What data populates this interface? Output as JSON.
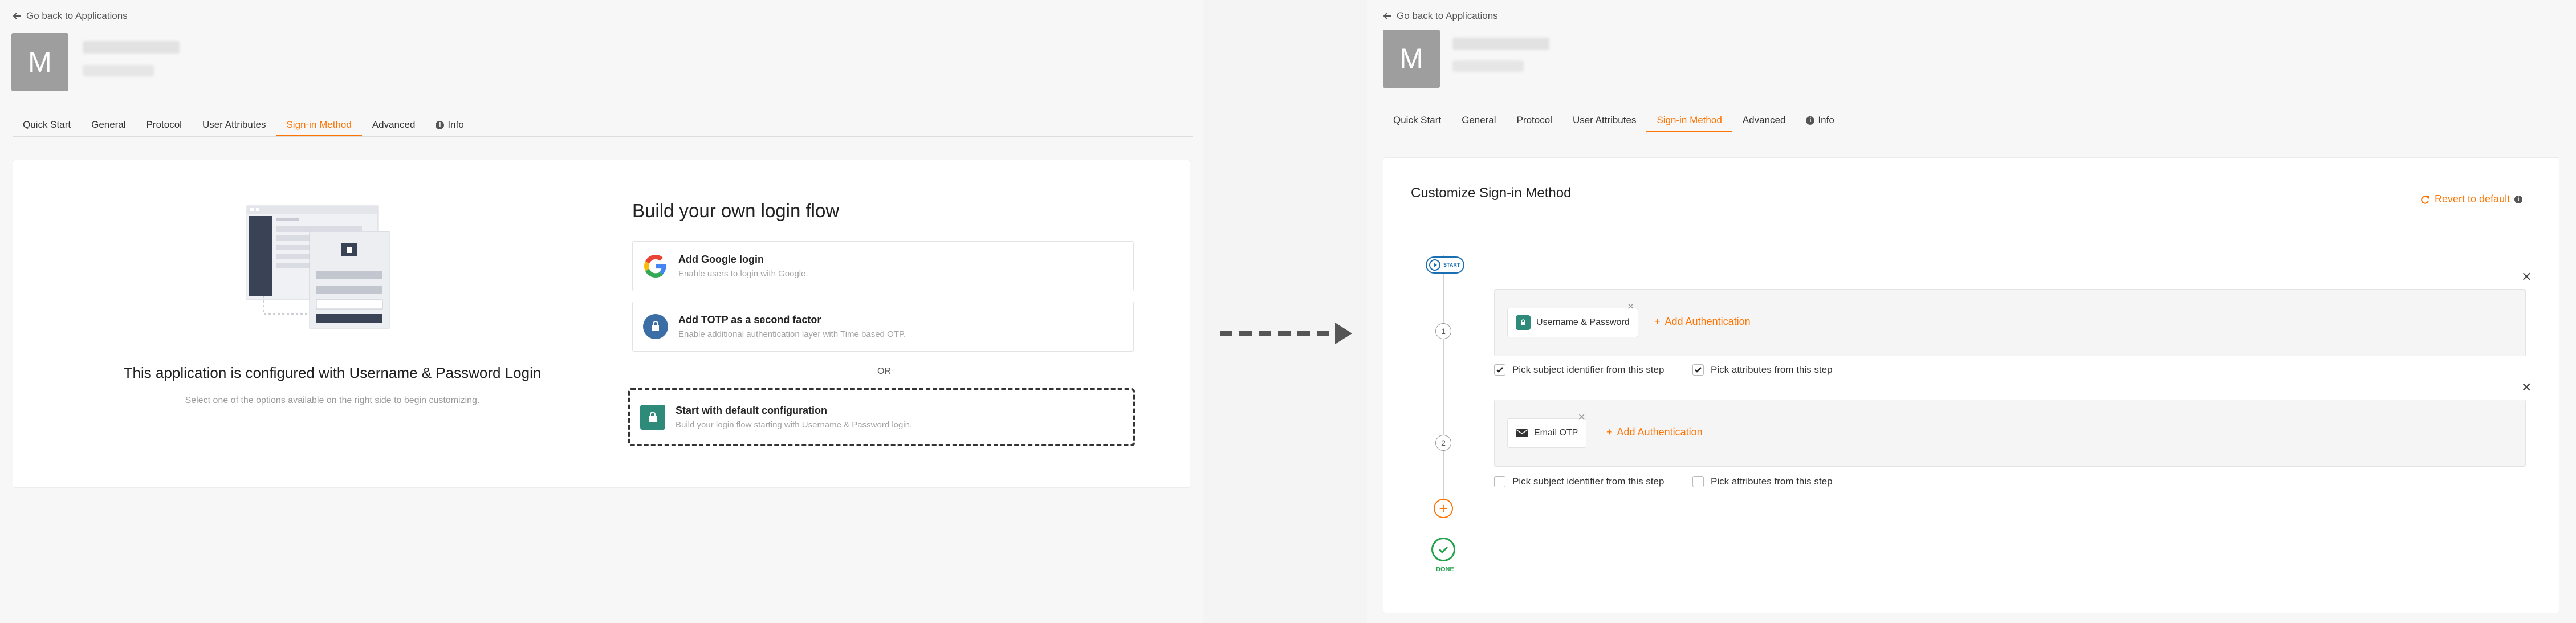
{
  "left": {
    "back_link": "Go back to Applications",
    "avatar_letter": "M",
    "tabs": [
      "Quick Start",
      "General",
      "Protocol",
      "User Attributes",
      "Sign-in Method",
      "Advanced",
      "Info"
    ],
    "active_tab": "Sign-in Method",
    "config_title": "This application is configured with Username & Password Login",
    "config_subtitle": "Select one of the options available on the right side to begin customizing.",
    "build_title": "Build your own login flow",
    "options": [
      {
        "title": "Add Google login",
        "description": "Enable users to login with Google.",
        "icon": "google-icon"
      },
      {
        "title": "Add TOTP as a second factor",
        "description": "Enable additional authentication layer with Time based OTP.",
        "icon": "totp-icon"
      }
    ],
    "or_text": "OR",
    "default_option": {
      "title": "Start with default configuration",
      "description": "Build your login flow starting with Username & Password login.",
      "icon": "lock-icon"
    }
  },
  "right": {
    "back_link": "Go back to Applications",
    "avatar_letter": "M",
    "tabs": [
      "Quick Start",
      "General",
      "Protocol",
      "User Attributes",
      "Sign-in Method",
      "Advanced",
      "Info"
    ],
    "active_tab": "Sign-in Method",
    "customize_title": "Customize Sign-in Method",
    "revert_label": "Revert to default",
    "start_label": "START",
    "done_label": "DONE",
    "steps": [
      {
        "number": "1",
        "authenticator": "Username & Password",
        "add_auth_label": "Add Authentication",
        "subject_label": "Pick subject identifier from this step",
        "attributes_label": "Pick attributes from this step",
        "subject_checked": true,
        "attributes_checked": true
      },
      {
        "number": "2",
        "authenticator": "Email OTP",
        "add_auth_label": "Add Authentication",
        "subject_label": "Pick subject identifier from this step",
        "attributes_label": "Pick attributes from this step",
        "subject_checked": false,
        "attributes_checked": false
      }
    ]
  },
  "colors": {
    "accent": "#ff7300",
    "success": "#22a24a",
    "start": "#1a6fb3",
    "teal": "#2e8b7a"
  }
}
